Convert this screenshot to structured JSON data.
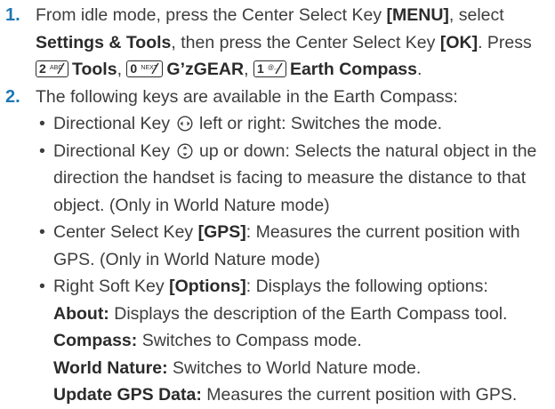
{
  "step1": {
    "num": "1.",
    "t1": " From idle mode, press the Center Select Key ",
    "b1": "[MENU]",
    "t2": ", select",
    "b2": "Settings & Tools",
    "t3": ", then press the Center Select Key ",
    "b3": "[OK]",
    "t4": ". Press",
    "key2_num": "2",
    "key2_sub": "ABC",
    "b4": "Tools",
    "t5": ", ",
    "key0_num": "0",
    "key0_sub": "NEXT",
    "b5": "G’zGEAR",
    "t6": ", ",
    "key1_num": "1",
    "key1_sub": "@,.",
    "b6": "Earth Compass",
    "t7": "."
  },
  "step2": {
    "num": "2.",
    "intro": " The following keys are available in the Earth Compass:",
    "bullet_glyph": "•",
    "b1": {
      "t1": "Directional Key ",
      "icon": "left-right-directional-icon",
      "t2": " left or right: Switches the mode."
    },
    "b2": {
      "t1": "Directional Key ",
      "icon": "up-down-directional-icon",
      "t2": " up or down: Selects the natural object in the",
      "l2": "direction the handset is facing to measure the distance to that",
      "l3": "object. (Only in World Nature mode)"
    },
    "b3": {
      "t1": "Center Select Key ",
      "b": "[GPS]",
      "t2": ": Measures the current position with",
      "l2": "GPS. (Only in World Nature mode)"
    },
    "b4": {
      "t1": "Right Soft Key ",
      "b": "[Options]",
      "t2": ": Displays the following options:"
    },
    "options": [
      {
        "label": "About:",
        "desc": " Displays the description of the Earth Compass tool."
      },
      {
        "label": "Compass:",
        "desc": " Switches to Compass mode."
      },
      {
        "label": "World Nature:",
        "desc": " Switches to World Nature mode."
      },
      {
        "label": "Update GPS Data:",
        "desc": " Measures the current position with GPS."
      }
    ]
  },
  "colors": {
    "accent": "#1e78b4",
    "text": "#3d3d3d"
  }
}
